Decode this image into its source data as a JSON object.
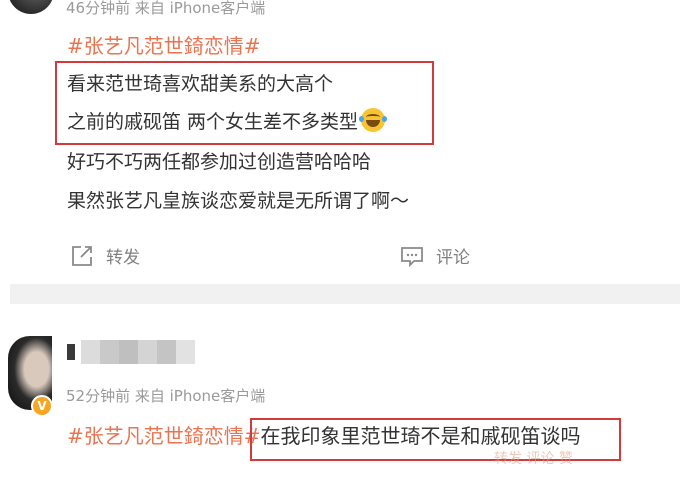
{
  "post1": {
    "meta": "46分钟前 来自 iPhone客户端",
    "hashtag": "#张艺凡范世錡恋情#",
    "lines": [
      "看来范世琦喜欢甜美系的大高个",
      "之前的戚砚笛 两个女生差不多类型",
      "好巧不巧两任都参加过创造营哈哈哈",
      "果然张艺凡皇族谈恋爱就是无所谓了啊～"
    ],
    "emoji": "laugh-cry-emoji",
    "actions": {
      "forward": "转发",
      "comment": "评论"
    }
  },
  "post2": {
    "meta": "52分钟前 来自 iPhone客户端",
    "hashtag": "#张艺凡范世錡恋情#",
    "text": "在我印象里范世琦不是和戚砚笛谈吗",
    "verified_badge": "V",
    "faded_text": "转发 评论 赞"
  },
  "colors": {
    "hashtag": "#eb7350",
    "highlight_box": "#d23b3b",
    "meta": "#9a9a9a",
    "divider": "#f1f1f1"
  }
}
